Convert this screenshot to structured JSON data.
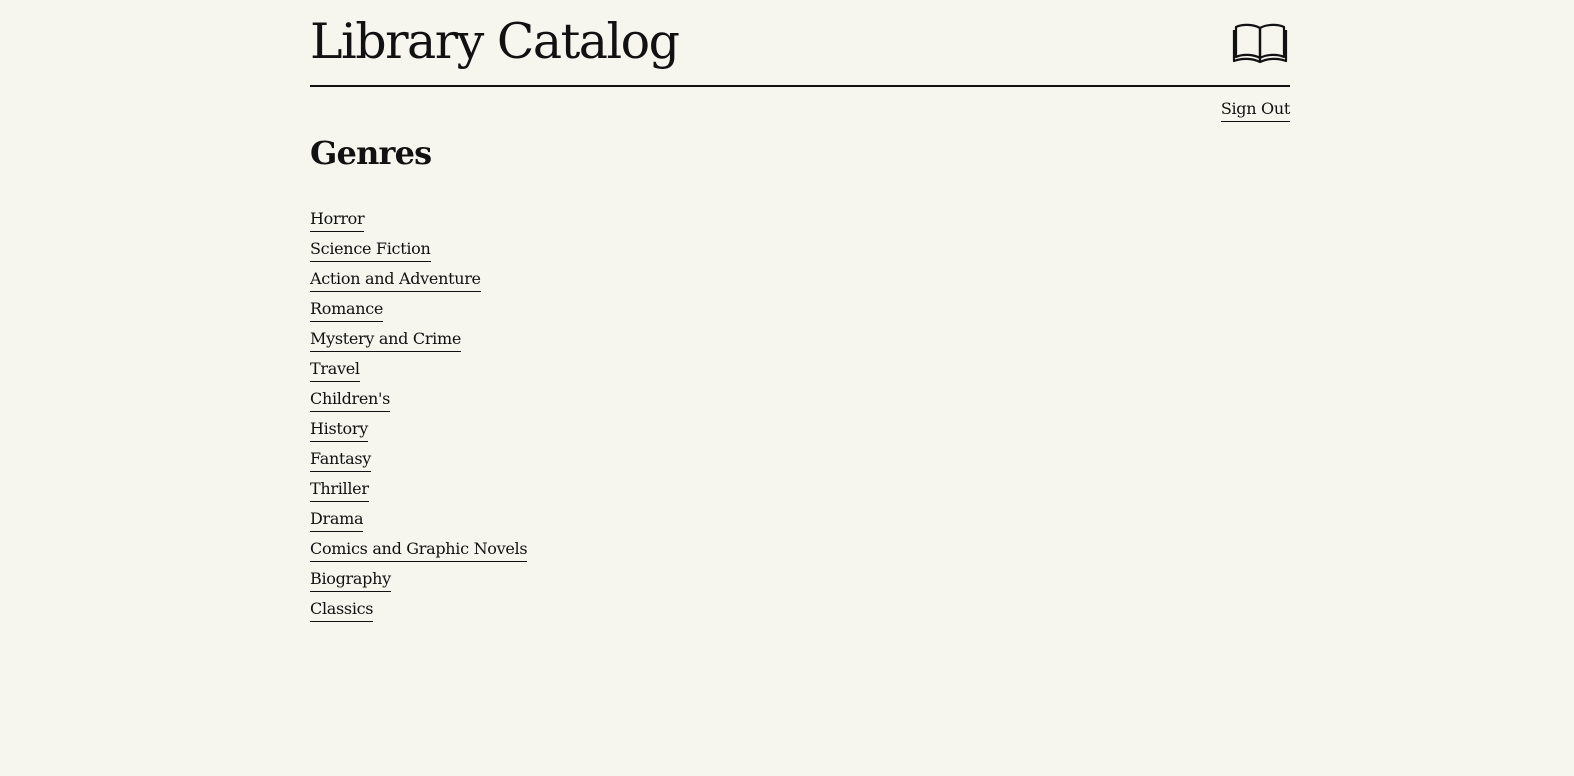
{
  "header": {
    "title": "Library Catalog",
    "logo_icon": "open-book-icon"
  },
  "nav": {
    "sign_out_label": "Sign Out"
  },
  "main": {
    "section_title": "Genres",
    "genres": [
      "Horror",
      "Science Fiction",
      "Action and Adventure",
      "Romance",
      "Mystery and Crime",
      "Travel",
      "Children's",
      "History",
      "Fantasy",
      "Thriller",
      "Drama",
      "Comics and Graphic Novels",
      "Biography",
      "Classics"
    ]
  },
  "colors": {
    "background": "#f6f6ef",
    "text": "#111111"
  }
}
